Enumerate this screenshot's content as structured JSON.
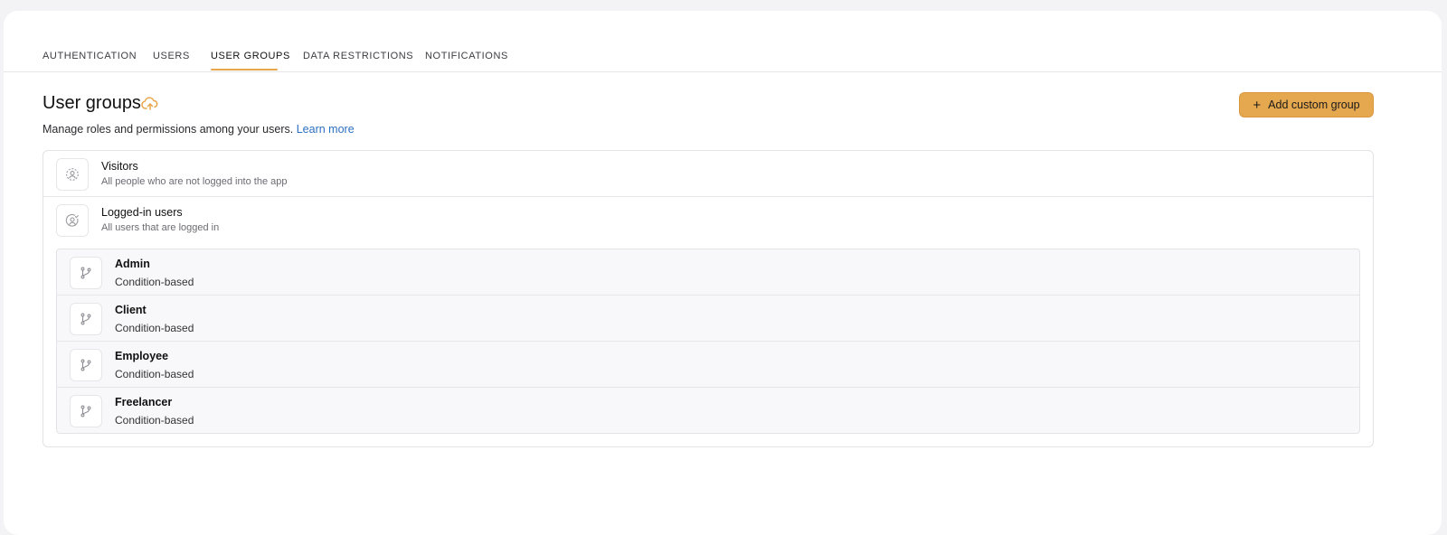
{
  "tabs": [
    {
      "label": "AUTHENTICATION",
      "active": false
    },
    {
      "label": "USERS",
      "active": false
    },
    {
      "label": "USER GROUPS",
      "active": true
    },
    {
      "label": "DATA RESTRICTIONS",
      "active": false
    },
    {
      "label": "NOTIFICATIONS",
      "active": false
    }
  ],
  "header": {
    "title": "User groups",
    "title_icon": "cloud-upload-icon",
    "subtitle": "Manage roles and permissions among your users.",
    "learn_more": "Learn more",
    "add_button_label": "Add custom group"
  },
  "groups": [
    {
      "name": "Visitors",
      "description": "All people who are not logged into the app",
      "icon": "visitor-icon"
    },
    {
      "name": "Logged-in users",
      "description": "All users that are logged in",
      "icon": "logged-in-user-icon"
    }
  ],
  "custom_groups": [
    {
      "name": "Admin",
      "type": "Condition-based",
      "icon": "branch-icon"
    },
    {
      "name": "Client",
      "type": "Condition-based",
      "icon": "branch-icon"
    },
    {
      "name": "Employee",
      "type": "Condition-based",
      "icon": "branch-icon"
    },
    {
      "name": "Freelancer",
      "type": "Condition-based",
      "icon": "branch-icon"
    }
  ],
  "colors": {
    "accent": "#e8a64b",
    "button_bg": "#e6a84f",
    "link": "#2b6fc2"
  }
}
